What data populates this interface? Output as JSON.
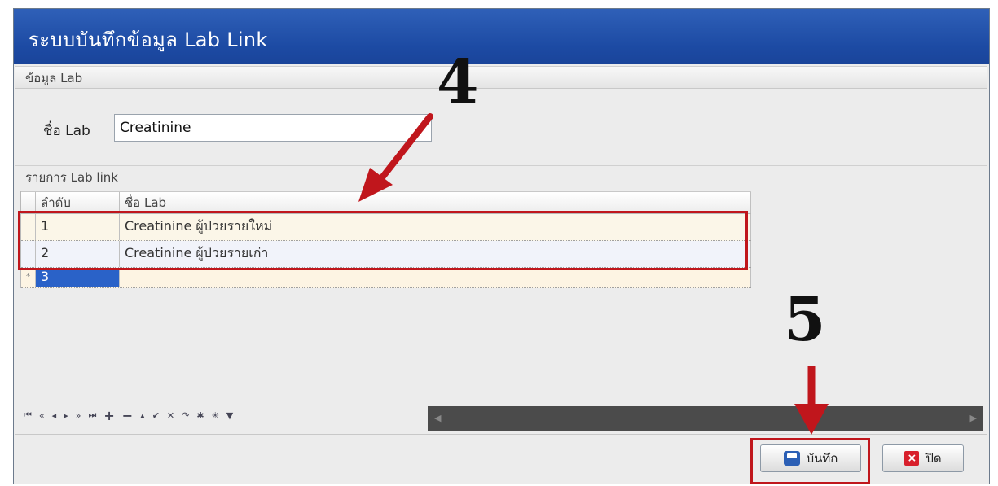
{
  "window": {
    "title": "ระบบบันทึกข้อมูล Lab Link"
  },
  "lab_section": {
    "header": "ข้อมูล Lab",
    "name_label": "ชื่อ Lab",
    "name_value": "Creatinine"
  },
  "link_section": {
    "header": "รายการ Lab link",
    "columns": [
      "ลำดับ",
      "ชื่อ Lab"
    ],
    "rows": [
      {
        "no": "1",
        "name": "Creatinine ผู้ป่วยรายใหม่"
      },
      {
        "no": "2",
        "name": "Creatinine ผู้ป่วยรายเก่า"
      }
    ],
    "new_row": {
      "marker": "*",
      "no": "3",
      "name": ""
    }
  },
  "navigator": {
    "buttons": [
      "⏮",
      "«",
      "◂",
      "▸",
      "»",
      "⏭",
      "+",
      "−",
      "▴",
      "✔",
      "✕",
      "↷",
      "✱",
      "✳",
      "▼"
    ]
  },
  "buttons": {
    "save": "บันทึก",
    "close": "ปิด"
  },
  "annotations": {
    "step4": "4",
    "step5": "5"
  },
  "colors": {
    "titlebar": "#1c4aa3",
    "highlight": "#c0161c",
    "selected": "#2a62c8"
  },
  "icons": {
    "save": "save-icon",
    "close": "close-icon"
  }
}
